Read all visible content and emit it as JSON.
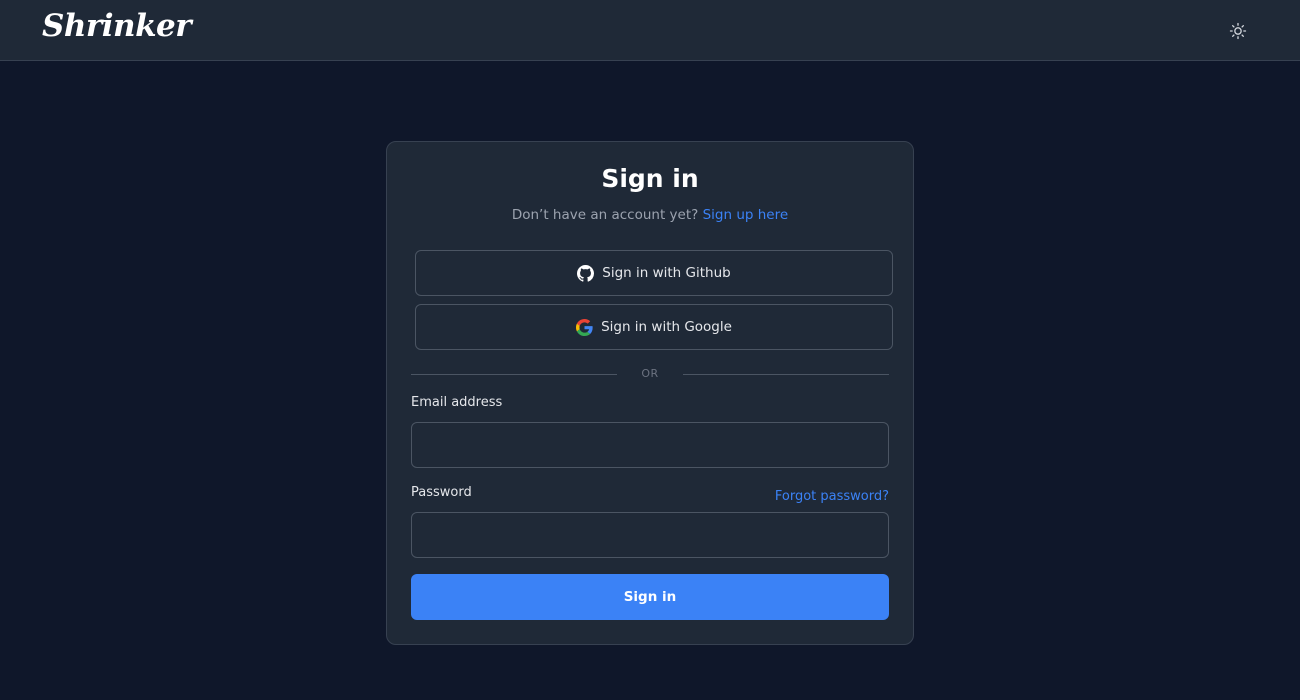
{
  "header": {
    "logo_text": "Shrinker",
    "theme_toggle_icon": "sun-icon"
  },
  "signin": {
    "title": "Sign in",
    "subtitle_text": "Don’t have an account yet?",
    "signup_link": "Sign up here",
    "github_label": "Sign in with Github",
    "google_label": "Sign in with Google",
    "divider_text": "OR",
    "email_label": "Email address",
    "email_value": "",
    "password_label": "Password",
    "password_value": "",
    "forgot_link": "Forgot password?",
    "submit_label": "Sign in"
  },
  "colors": {
    "background": "#0f172a",
    "header_bg": "#1f2937",
    "card_bg": "#1f2937",
    "accent": "#3b82f6",
    "border": "#4b5563"
  }
}
